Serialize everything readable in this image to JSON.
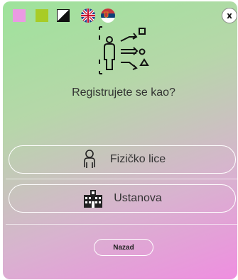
{
  "question": "Registrujete se kao?",
  "options": [
    {
      "label": "Fizičko lice",
      "icon": "person-icon"
    },
    {
      "label": "Ustanova",
      "icon": "building-icon"
    }
  ],
  "back_label": "Nazad",
  "close_label": "x",
  "themes": [
    {
      "name": "pink-theme",
      "color": "#ea9ae2"
    },
    {
      "name": "green-theme",
      "color": "#a8cc26"
    },
    {
      "name": "high-contrast-theme",
      "color": "#111111"
    }
  ],
  "languages": [
    {
      "icon": "uk-flag-icon"
    },
    {
      "icon": "serbia-flag-icon"
    }
  ]
}
